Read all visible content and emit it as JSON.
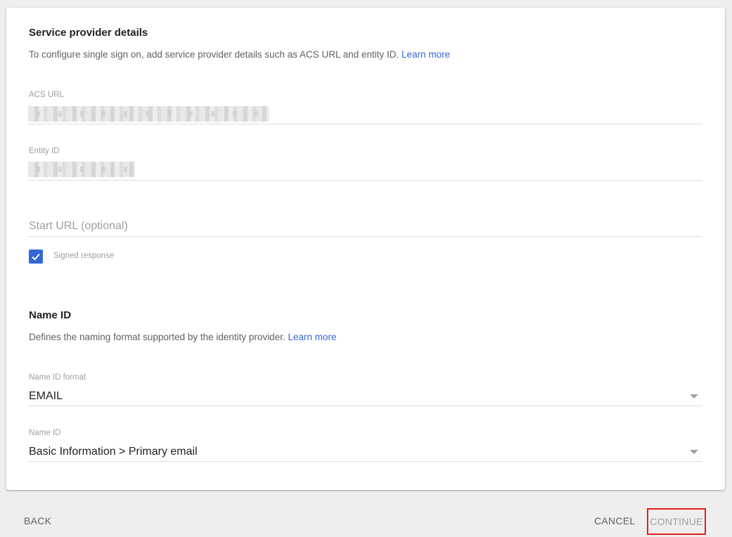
{
  "service_provider": {
    "title": "Service provider details",
    "description": "To configure single sign on, add service provider details such as ACS URL and entity ID.",
    "learn_more": "Learn more",
    "acs_url_label": "ACS URL",
    "entity_id_label": "Entity ID",
    "start_url_placeholder": "Start URL (optional)",
    "signed_response_label": "Signed response",
    "signed_response_checked": true
  },
  "name_id_section": {
    "title": "Name ID",
    "description": "Defines the naming format supported by the identity provider.",
    "learn_more": "Learn more",
    "format_label": "Name ID format",
    "format_value": "EMAIL",
    "name_id_label": "Name ID",
    "name_id_value": "Basic Information > Primary email"
  },
  "footer": {
    "back_label": "BACK",
    "cancel_label": "CANCEL",
    "continue_label": "CONTINUE"
  },
  "colors": {
    "accent": "#3367d6",
    "highlight_border": "#e02020"
  },
  "icons": {
    "checkbox": "check-icon",
    "dropdown": "dropdown-arrow-icon"
  }
}
